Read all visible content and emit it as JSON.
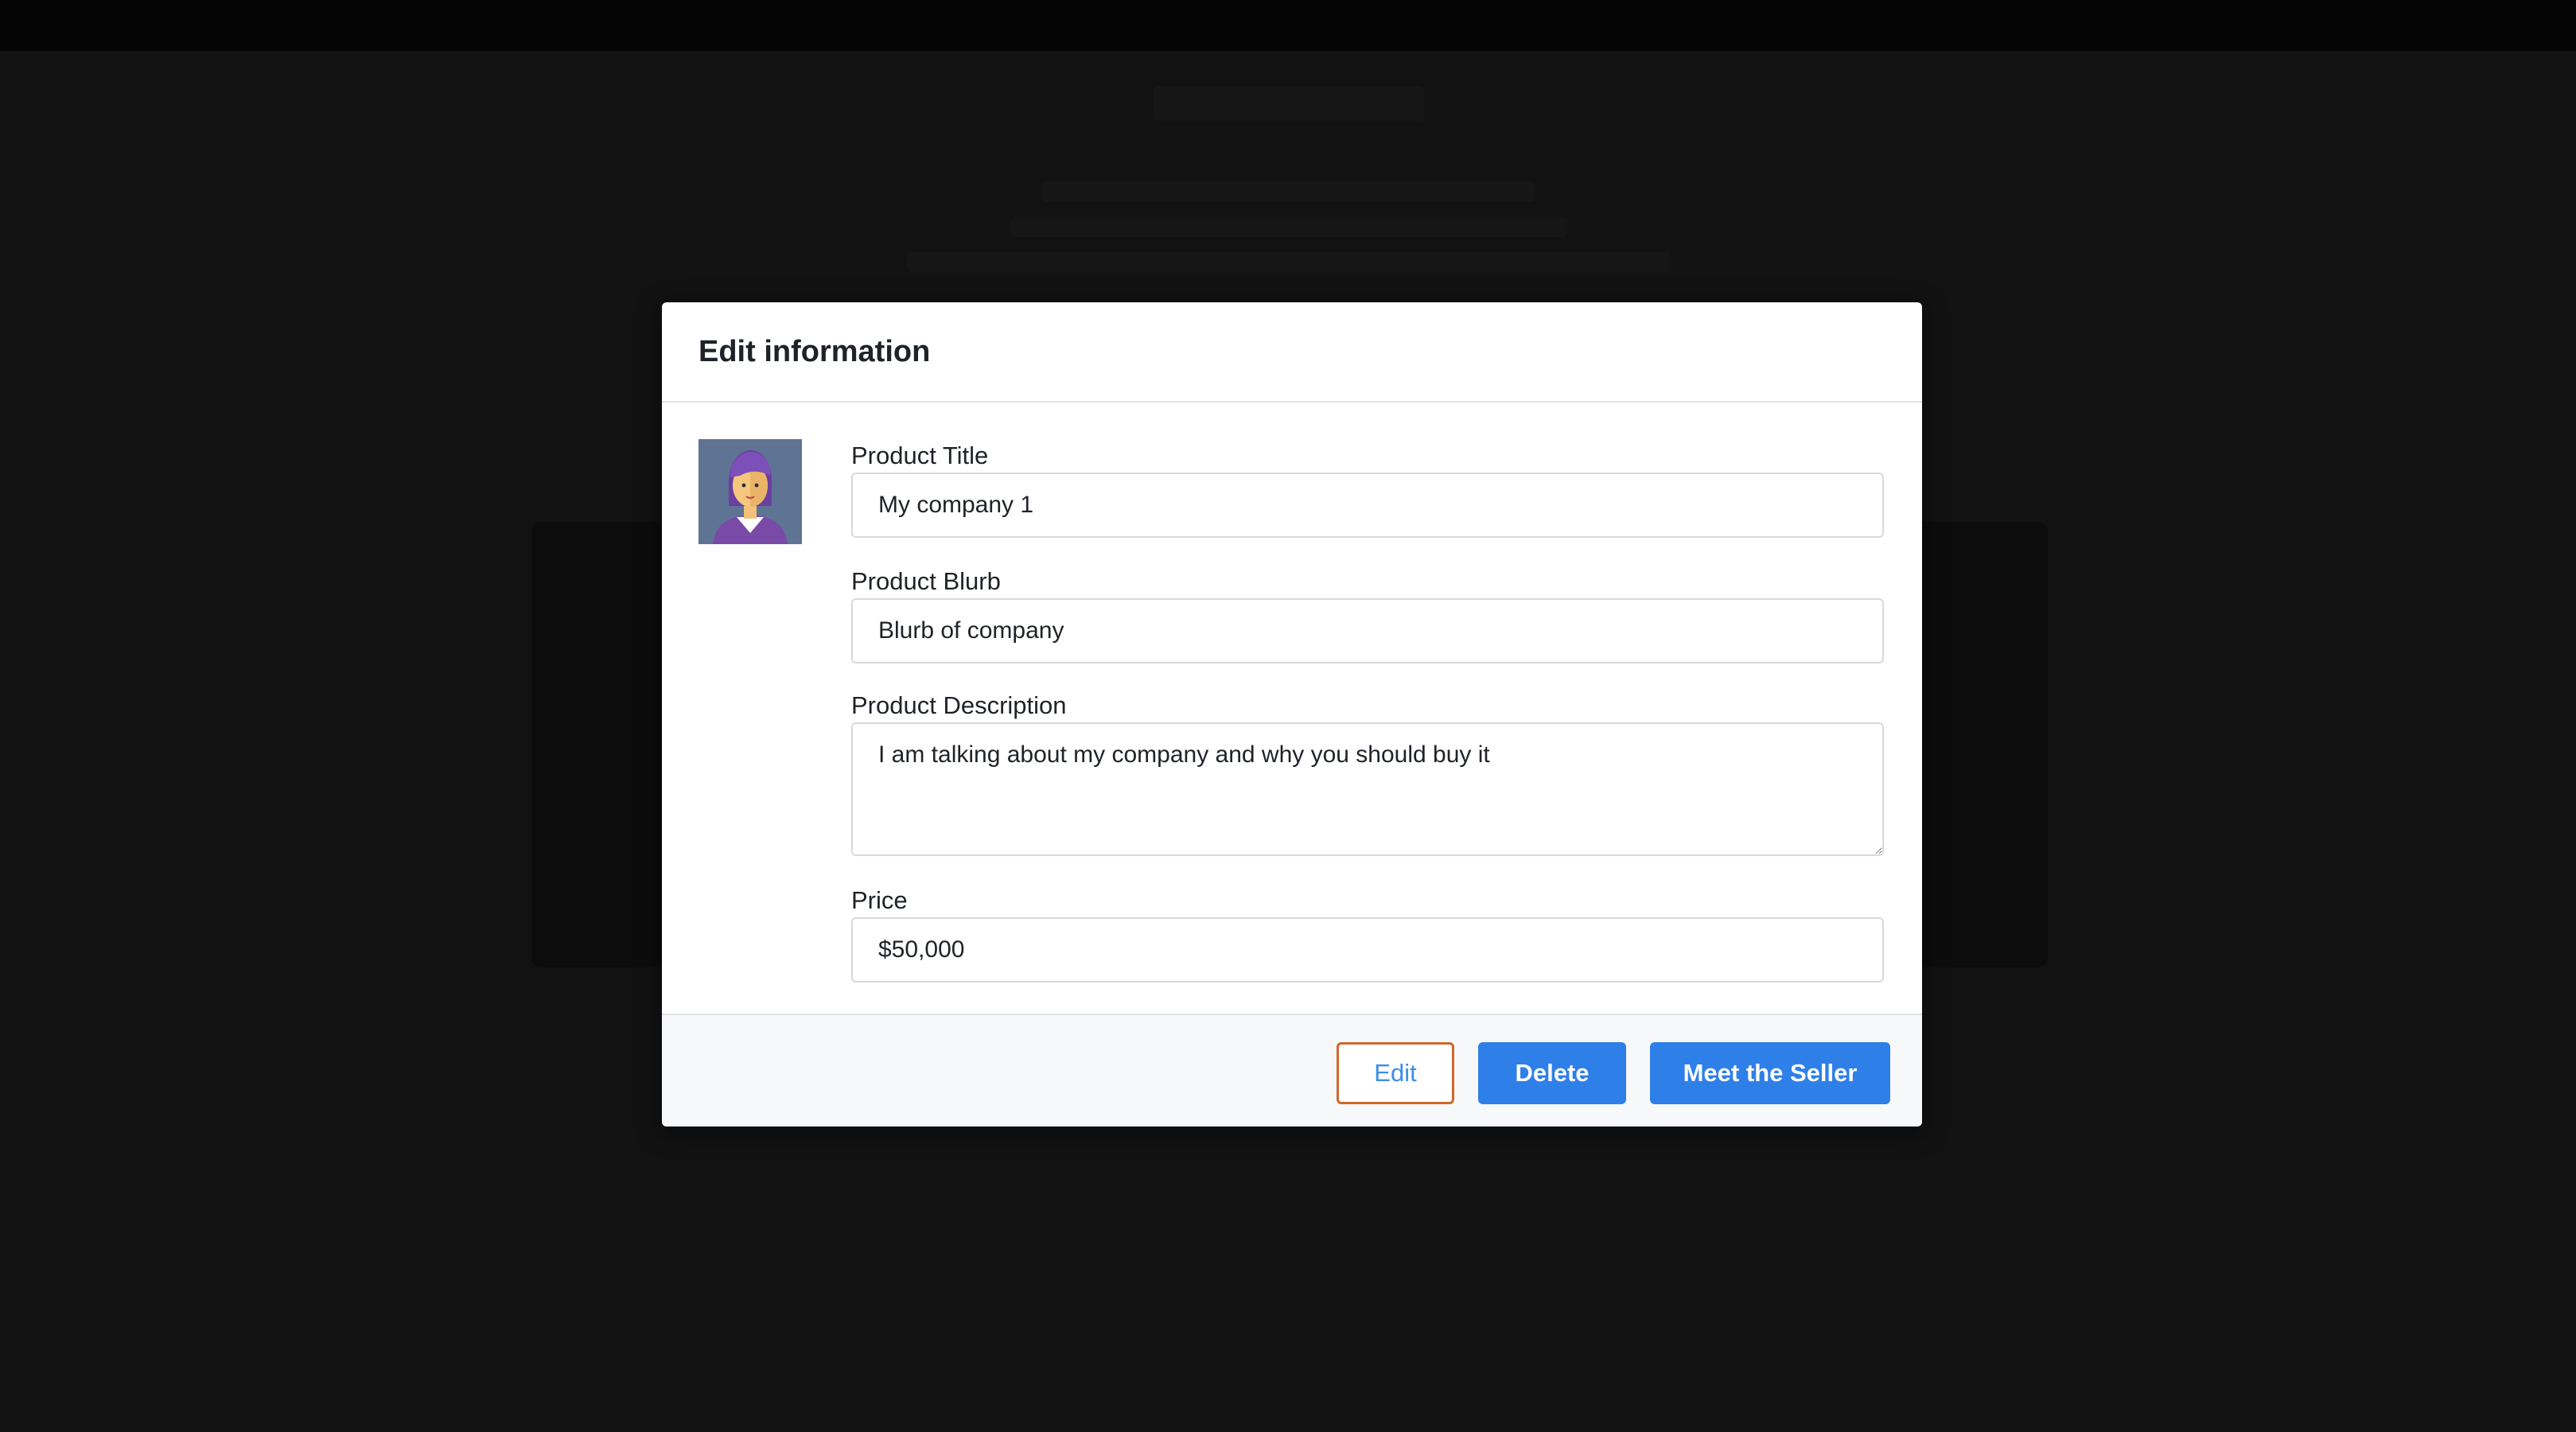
{
  "modal": {
    "title": "Edit information"
  },
  "form": {
    "product_title": {
      "label": "Product Title",
      "value": "My company 1"
    },
    "product_blurb": {
      "label": "Product Blurb",
      "value": "Blurb of company"
    },
    "product_description": {
      "label": "Product Description",
      "value": "I am talking about my company and why you should buy it"
    },
    "price": {
      "label": "Price",
      "value": "$50,000"
    }
  },
  "footer": {
    "edit_label": "Edit",
    "delete_label": "Delete",
    "meet_label": "Meet the Seller"
  },
  "icons": {
    "avatar": "user-avatar-icon",
    "resize": "resize-handle-icon"
  },
  "colors": {
    "primary": "#2f7fe8",
    "edit_border": "#d0672a",
    "edit_text": "#3c8ee8",
    "overlay": "#121212",
    "avatar_bg": "#5f7394"
  }
}
